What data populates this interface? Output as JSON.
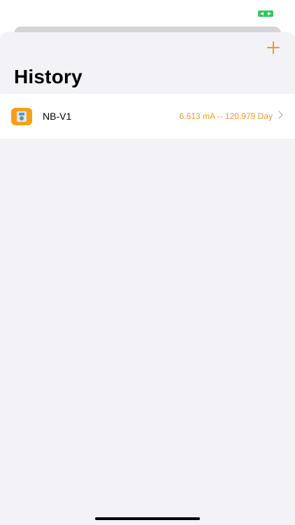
{
  "status_bar": {
    "battery_icon": "battery-charging-icon",
    "battery_color": "#34c759"
  },
  "header": {
    "title": "History",
    "add_icon": "plus-icon",
    "accent_color": "#f19a2b"
  },
  "history": {
    "items": [
      {
        "name": "NB-V1",
        "value": "6.613 mA -- 120.979 Day",
        "icon": "device-icon"
      }
    ]
  }
}
